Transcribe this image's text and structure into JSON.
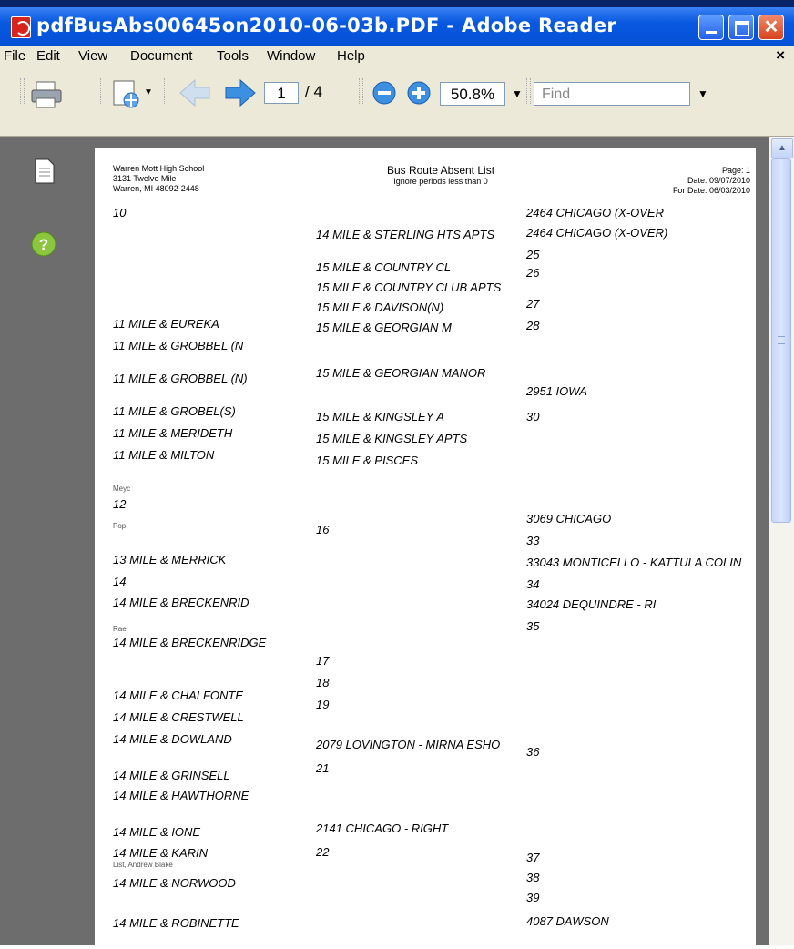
{
  "window": {
    "title": "pdfBusAbs00645on2010-06-03b.PDF - Adobe Reader",
    "close_glyph": "✕"
  },
  "menu": {
    "items": [
      "File",
      "Edit",
      "View",
      "Document",
      "Tools",
      "Window",
      "Help"
    ],
    "close_doc": "×"
  },
  "toolbar": {
    "page_current": "1",
    "page_total": "/ 4",
    "zoom": "50.8%",
    "find_placeholder": "Find",
    "dropdown_glyph": "▼"
  },
  "scrollbar": {
    "up_glyph": "▲"
  },
  "document": {
    "header": {
      "school_lines": [
        "Warren Mott High School",
        "3131 Twelve Mile",
        "Warren, MI 48092-2448"
      ],
      "title": "Bus Route Absent List",
      "subtitle": "Ignore periods less than 0",
      "page": "Page: 1",
      "date": "Date: 09/07/2010",
      "for_date": "For Date: 06/03/2010"
    },
    "column1": [
      "10",
      "11 MILE & EUREKA",
      "11 MILE & GROBBEL (N",
      "11 MILE & GROBBEL (N)",
      "11 MILE & GROBEL(S)",
      "11 MILE & MERIDETH",
      "11 MILE & MILTON",
      "12",
      "13 MILE & MERRICK",
      "14",
      "14 MILE & BRECKENRID",
      "14 MILE & BRECKENRIDGE",
      "14 MILE & CHALFONTE",
      "14 MILE & CRESTWELL",
      "14 MILE & DOWLAND",
      "14 MILE & GRINSELL",
      "14 MILE & HAWTHORNE",
      "14 MILE & IONE",
      "14 MILE & KARIN",
      "14 MILE & NORWOOD",
      "14 MILE & ROBINETTE"
    ],
    "column2": [
      "14 MILE & STERLING HTS APTS",
      "15 MILE & COUNTRY CL",
      "15 MILE & COUNTRY CLUB APTS",
      "15 MILE & DAVISON(N)",
      "15 MILE & GEORGIAN M",
      "15 MILE & GEORGIAN MANOR",
      "15 MILE & KINGSLEY A",
      "15 MILE & KINGSLEY APTS",
      "15 MILE & PISCES",
      "16",
      "17",
      "18",
      "19",
      "2079 LOVINGTON  - MIRNA ESHO",
      "21",
      "2141 CHICAGO - RIGHT",
      "22"
    ],
    "column3": [
      "2464 CHICAGO (X-OVER",
      "2464 CHICAGO (X-OVER)",
      "25",
      "26",
      "27",
      "28",
      "2951 IOWA",
      "30",
      "3069 CHICAGO",
      "33",
      "33043 MONTICELLO - KATTULA COLIN",
      "34",
      "34024 DEQUINDRE - RI",
      "35",
      "36",
      "37",
      "38",
      "39",
      "4087 DAWSON"
    ],
    "student_fragments": {
      "karin": "List, Andrew Blake",
      "f1": "Meyc",
      "f2": "Pop",
      "f3": "Rae"
    }
  }
}
